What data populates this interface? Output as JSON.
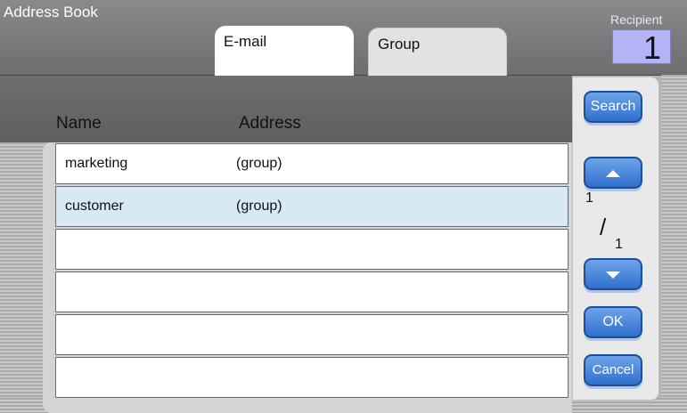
{
  "app_title": "Address Book",
  "tabs": [
    {
      "label": "E-mail",
      "active": true
    },
    {
      "label": "Group",
      "active": false
    }
  ],
  "recipient": {
    "label": "Recipient",
    "count": "1"
  },
  "columns": {
    "name": "Name",
    "address": "Address"
  },
  "rows": [
    {
      "name": "marketing",
      "address": "(group)",
      "selected": false
    },
    {
      "name": "customer",
      "address": "(group)",
      "selected": true
    },
    {
      "name": "",
      "address": "",
      "selected": false
    },
    {
      "name": "",
      "address": "",
      "selected": false
    },
    {
      "name": "",
      "address": "",
      "selected": false
    },
    {
      "name": "",
      "address": "",
      "selected": false
    }
  ],
  "buttons": {
    "search": "Search",
    "ok": "OK",
    "cancel": "Cancel",
    "page_up_icon": "triangle-up-icon",
    "page_down_icon": "triangle-down-icon"
  },
  "pagination": {
    "current": "1",
    "separator": "/",
    "total": "1"
  },
  "colors": {
    "accent_button": "#3a7bd5",
    "selected_row": "#d6e9f5",
    "recipient_box": "#b3b3f5",
    "header": "#7a7a7c"
  }
}
